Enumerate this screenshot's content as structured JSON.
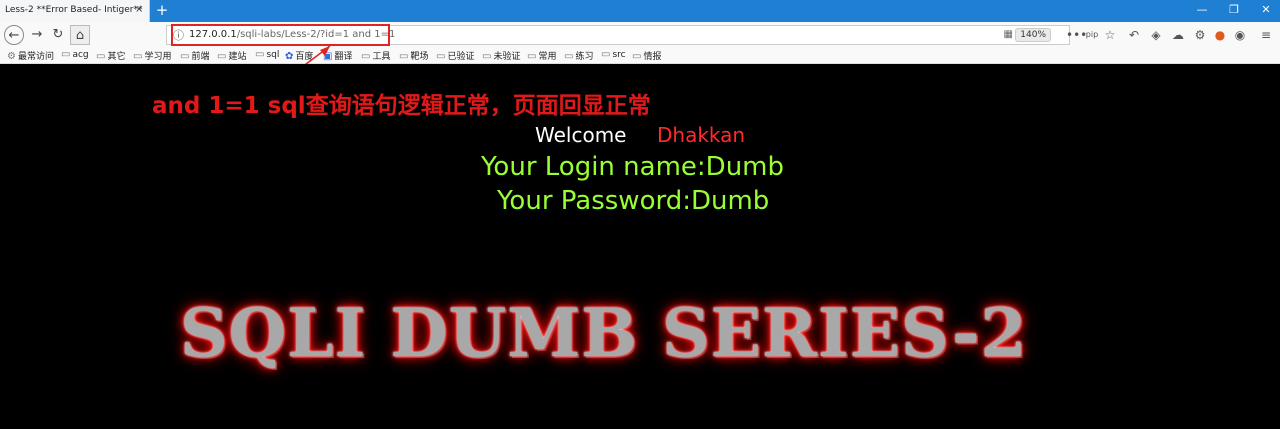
{
  "browser": {
    "tab_title": "Less-2 **Error Based- Intiger**",
    "tab_close": "×",
    "new_tab": "+",
    "window_controls": {
      "minimize": "—",
      "restore": "❐",
      "close": "✕"
    },
    "url": {
      "host": "127.0.0.1",
      "path": "/sqli-labs/Less-2/?id=1 and 1=1"
    },
    "zoom": "140%",
    "toolbar_icons": [
      "page-actions-icon",
      "pip-icon",
      "bookmark-star-icon",
      "undo-icon",
      "shield-icon",
      "cloud-icon",
      "gear-icon",
      "extension-icon",
      "sync-icon",
      "menu-icon"
    ],
    "bookmarks": [
      {
        "label": "最常访问",
        "icon": "gear-icon"
      },
      {
        "label": "acg",
        "icon": "folder-icon"
      },
      {
        "label": "其它",
        "icon": "folder-icon"
      },
      {
        "label": "学习用",
        "icon": "folder-icon"
      },
      {
        "label": "前端",
        "icon": "folder-icon"
      },
      {
        "label": "建站",
        "icon": "folder-icon"
      },
      {
        "label": "sql",
        "icon": "folder-icon"
      },
      {
        "label": "百度",
        "icon": "paw-icon"
      },
      {
        "label": "翻译",
        "icon": "translate-icon"
      },
      {
        "label": "工具",
        "icon": "folder-icon"
      },
      {
        "label": "靶场",
        "icon": "folder-icon"
      },
      {
        "label": "已验证",
        "icon": "folder-icon"
      },
      {
        "label": "未验证",
        "icon": "folder-icon"
      },
      {
        "label": "常用",
        "icon": "folder-icon"
      },
      {
        "label": "练习",
        "icon": "folder-icon"
      },
      {
        "label": "src",
        "icon": "folder-icon"
      },
      {
        "label": "情报",
        "icon": "folder-icon"
      }
    ]
  },
  "page": {
    "annotation": "and 1=1 sql查询语句逻辑正常，页面回显正常",
    "welcome_label": "Welcome",
    "welcome_name": "Dhakkan",
    "login_line": "Your Login name:Dumb",
    "password_line": "Your Password:Dumb",
    "banner": "SQLI DUMB SERIES-2"
  },
  "colors": {
    "annotation_red": "#e21919",
    "result_green": "#99ff33",
    "name_red": "#ff2a2a",
    "title_blue": "#1f7fd3"
  }
}
